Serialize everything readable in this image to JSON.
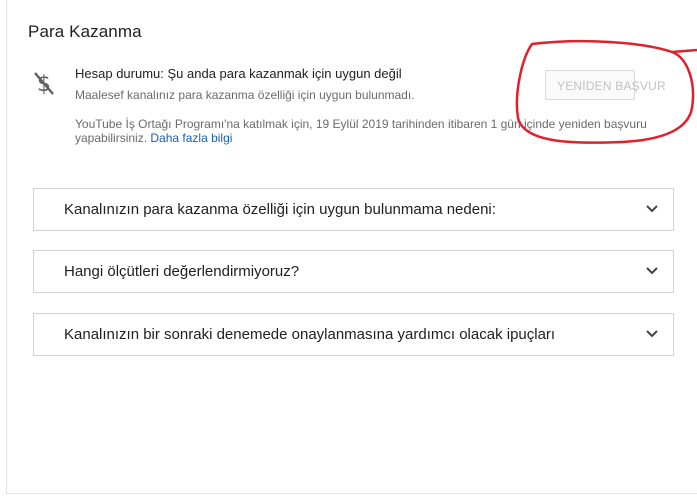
{
  "page": {
    "title": "Para Kazanma"
  },
  "status": {
    "icon": "no-money-icon",
    "label": "Hesap durumu: Şu anda para kazanmak için uygun değil",
    "sublabel": "Maalesef kanalınız para kazanma özelliği için uygun bulunmadı.",
    "reapply_button": "YENİDEN BAŞVUR"
  },
  "info": {
    "line1": "YouTube İş Ortağı Programı'na katılmak için, 19 Eylül 2019 tarihinden itibaren 1 gün içinde yeniden başvuru",
    "line2_prefix": "yapabilirsiniz. ",
    "link": "Daha fazla bilgi"
  },
  "accordions": [
    {
      "label": "Kanalınızın para kazanma özelliği için uygun bulunmama nedeni:"
    },
    {
      "label": "Hangi ölçütleri değerlendirmiyoruz?"
    },
    {
      "label": "Kanalınızın bir sonraki denemede onaylanmasına yardımcı olacak ipuçları"
    }
  ],
  "colors": {
    "annotation": "#e0202a",
    "link": "#1a5fb4"
  }
}
